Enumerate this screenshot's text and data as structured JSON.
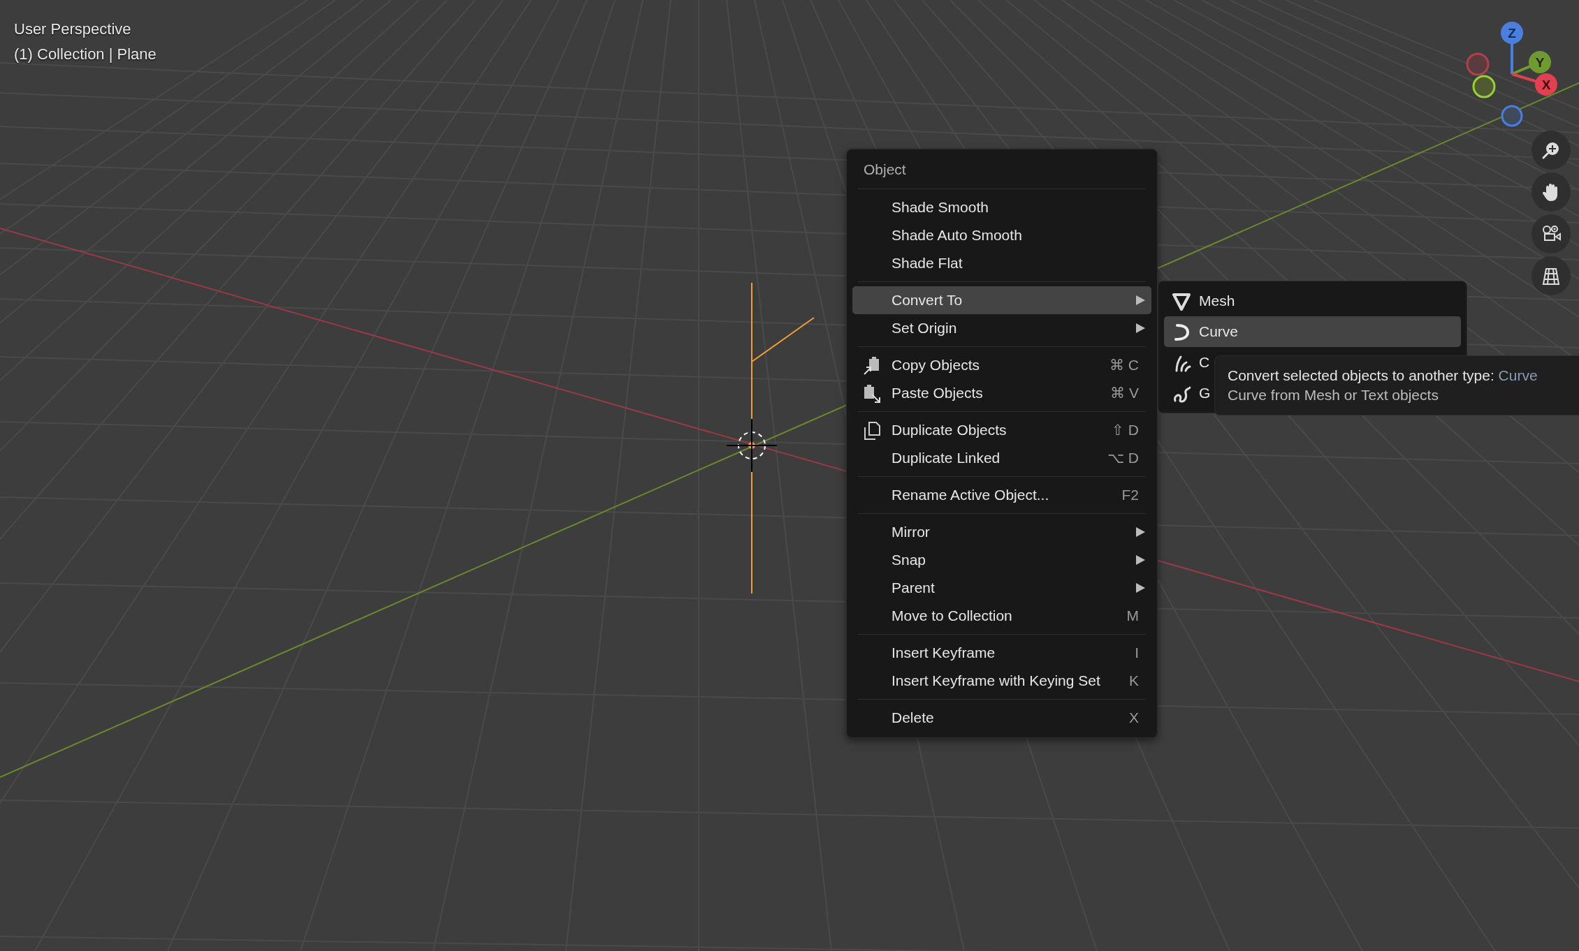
{
  "viewport": {
    "view_name": "User Perspective",
    "context": "(1) Collection | Plane"
  },
  "gizmo": {
    "axes": [
      {
        "label": "Z",
        "kind": "z"
      },
      {
        "label": "Y",
        "kind": "y"
      },
      {
        "label": "X",
        "kind": "x"
      }
    ]
  },
  "navigation": [
    {
      "kind": "zoom"
    },
    {
      "kind": "pan"
    },
    {
      "kind": "camera"
    },
    {
      "kind": "ortho"
    }
  ],
  "menu": {
    "title": "Object",
    "sections": [
      [
        {
          "label": "Shade Smooth",
          "kind": "plain",
          "submenu": false,
          "selected": false
        },
        {
          "label": "Shade Auto Smooth",
          "kind": "plain",
          "submenu": false,
          "selected": false
        },
        {
          "label": "Shade Flat",
          "kind": "plain",
          "submenu": false,
          "selected": false
        }
      ],
      [
        {
          "label": "Convert To",
          "kind": "plain",
          "submenu": true,
          "selected": true
        },
        {
          "label": "Set Origin",
          "kind": "plain",
          "submenu": true,
          "selected": false
        }
      ],
      [
        {
          "label": "Copy Objects",
          "kind": "copy",
          "shortcut": "⌘ C",
          "submenu": false,
          "selected": false
        },
        {
          "label": "Paste Objects",
          "kind": "paste",
          "shortcut": "⌘ V",
          "submenu": false,
          "selected": false
        }
      ],
      [
        {
          "label": "Duplicate Objects",
          "kind": "duplicate",
          "shortcut": "⇧ D",
          "submenu": false,
          "selected": false
        },
        {
          "label": "Duplicate Linked",
          "kind": "plain",
          "shortcut": "⌥ D",
          "submenu": false,
          "selected": false
        }
      ],
      [
        {
          "label": "Rename Active Object...",
          "kind": "plain",
          "shortcut": "F2",
          "submenu": false,
          "selected": false
        }
      ],
      [
        {
          "label": "Mirror",
          "kind": "plain",
          "submenu": true,
          "selected": false
        },
        {
          "label": "Snap",
          "kind": "plain",
          "submenu": true,
          "selected": false
        },
        {
          "label": "Parent",
          "kind": "plain",
          "submenu": true,
          "selected": false
        },
        {
          "label": "Move to Collection",
          "kind": "plain",
          "shortcut": "M",
          "submenu": false,
          "selected": false
        }
      ],
      [
        {
          "label": "Insert Keyframe",
          "kind": "plain",
          "shortcut": "I",
          "submenu": false,
          "selected": false
        },
        {
          "label": "Insert Keyframe with Keying Set",
          "kind": "plain",
          "shortcut": "K",
          "submenu": false,
          "selected": false
        }
      ],
      [
        {
          "label": "Delete",
          "kind": "plain",
          "shortcut": "X",
          "submenu": false,
          "selected": false
        }
      ]
    ]
  },
  "submenu": {
    "items": [
      {
        "label": "Mesh",
        "kind": "mesh",
        "selected": false
      },
      {
        "label": "Curve",
        "kind": "curve",
        "selected": true
      },
      {
        "label": "C",
        "kind": "curves",
        "selected": false
      },
      {
        "label": "G",
        "kind": "pencil",
        "selected": false
      }
    ]
  },
  "tooltip": {
    "text": "Convert selected objects to another type:",
    "value": "Curve",
    "description": "Curve from Mesh or Text objects"
  }
}
